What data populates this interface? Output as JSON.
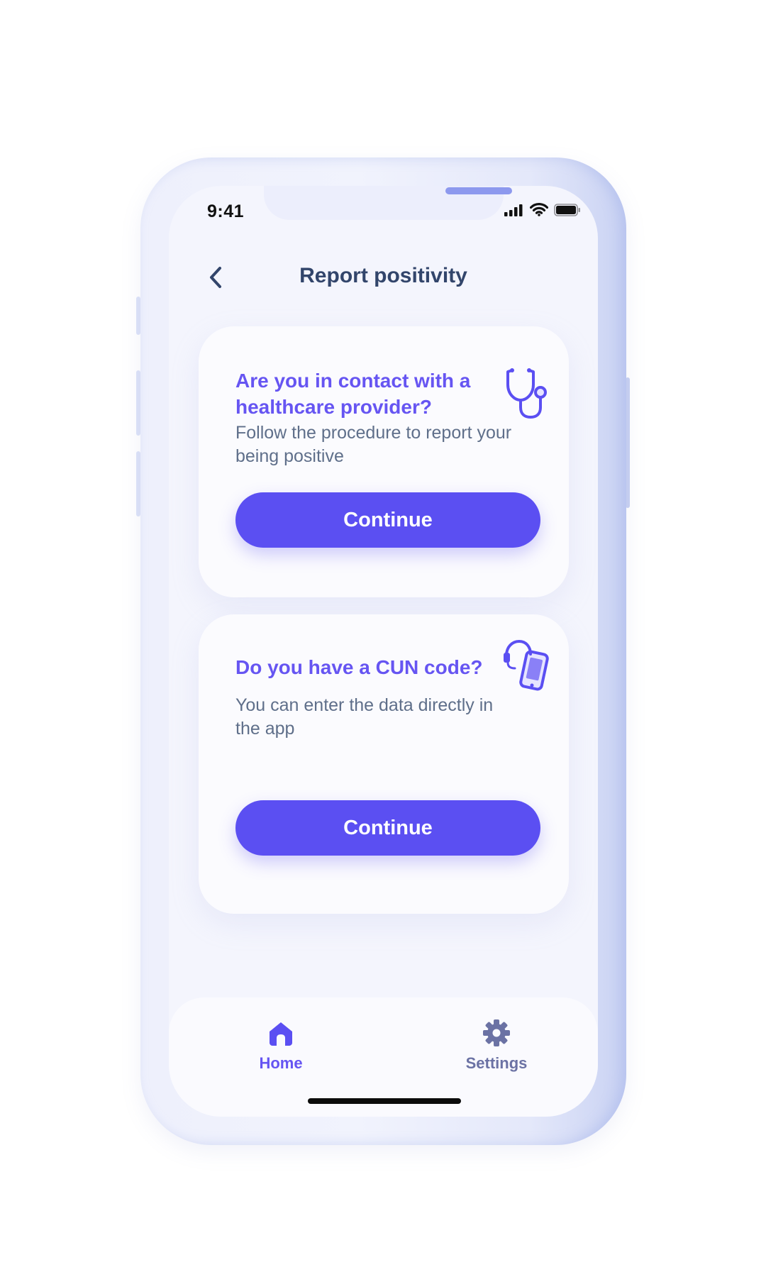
{
  "status_bar": {
    "time": "9:41"
  },
  "header": {
    "title": "Report positivity",
    "back_icon": "chevron-left-icon"
  },
  "cards": [
    {
      "title": "Are you in contact with a healthcare provider?",
      "description": "Follow the procedure to report your being positive",
      "button_label": "Continue",
      "icon": "stethoscope-icon"
    },
    {
      "title": "Do you have a CUN code?",
      "description": "You can enter the data directly in the app",
      "button_label": "Continue",
      "icon": "phone-support-icon"
    }
  ],
  "tab_bar": {
    "items": [
      {
        "label": "Home",
        "icon": "home-icon",
        "active": true
      },
      {
        "label": "Settings",
        "icon": "gear-icon",
        "active": false
      }
    ]
  },
  "colors": {
    "accent": "#5b4ff2",
    "title_accent": "#6655f2",
    "header_text": "#32456b",
    "body_text": "#5f6f8a",
    "screen_bg": "#f4f5fd",
    "card_bg": "#fbfbfe",
    "inactive_tab": "#6b72a4"
  }
}
